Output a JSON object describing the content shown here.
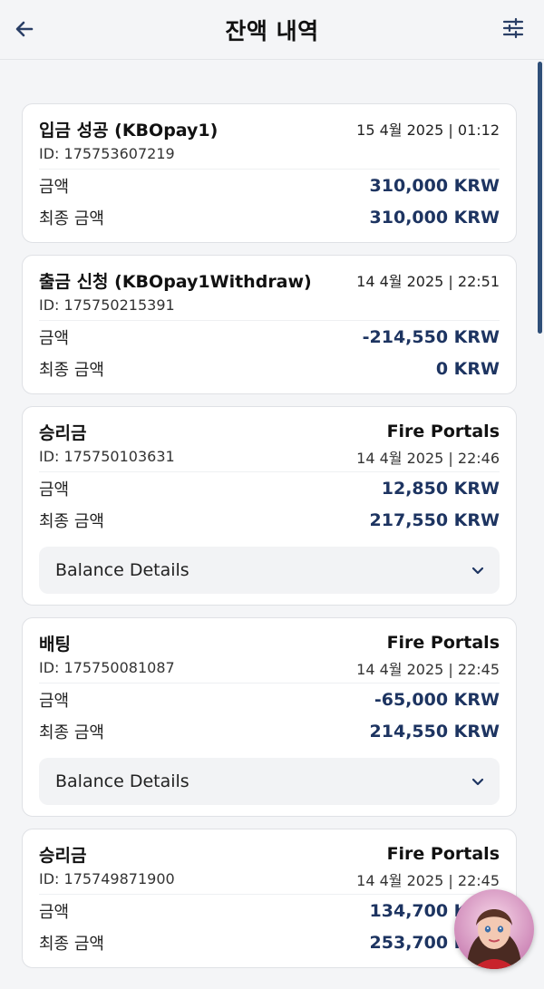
{
  "header": {
    "title": "잔액 내역",
    "back_icon": "arrow-left-icon",
    "filter_icon": "sliders-icon"
  },
  "transactions": [
    {
      "type": "입금 성공 (KBOpay1)",
      "top_right": "15 4월 2025 | 01:12",
      "id": "ID: 175753607219",
      "date": "",
      "amount_label": "금액",
      "amount": "310,000 KRW",
      "final_label": "최종 금액",
      "final_amount": "310,000 KRW"
    },
    {
      "type": "출금 신청 (KBOpay1Withdraw)",
      "top_right": "14 4월 2025 | 22:51",
      "id": "ID: 175750215391",
      "date": "",
      "amount_label": "금액",
      "amount": "-214,550 KRW",
      "final_label": "최종 금액",
      "final_amount": "0 KRW"
    },
    {
      "type": "승리금",
      "top_right": "Fire Portals",
      "id": "ID: 175750103631",
      "date": "14 4월 2025 | 22:46",
      "amount_label": "금액",
      "amount": "12,850 KRW",
      "final_label": "최종 금액",
      "final_amount": "217,550 KRW",
      "details_label": "Balance Details"
    },
    {
      "type": "배팅",
      "top_right": "Fire Portals",
      "id": "ID: 175750081087",
      "date": "14 4월 2025 | 22:45",
      "amount_label": "금액",
      "amount": "-65,000 KRW",
      "final_label": "최종 금액",
      "final_amount": "214,550 KRW",
      "details_label": "Balance Details"
    },
    {
      "type": "승리금",
      "top_right": "Fire Portals",
      "id": "ID: 175749871900",
      "date": "14 4월 2025 | 22:45",
      "amount_label": "금액",
      "amount": "134,700 KRW",
      "final_label": "최종 금액",
      "final_amount": "253,700 KRW"
    }
  ],
  "colors": {
    "accent": "#1d3461",
    "background": "#f4f5f7",
    "card": "#ffffff"
  },
  "chat_avatar_icon": "support-avatar-icon"
}
